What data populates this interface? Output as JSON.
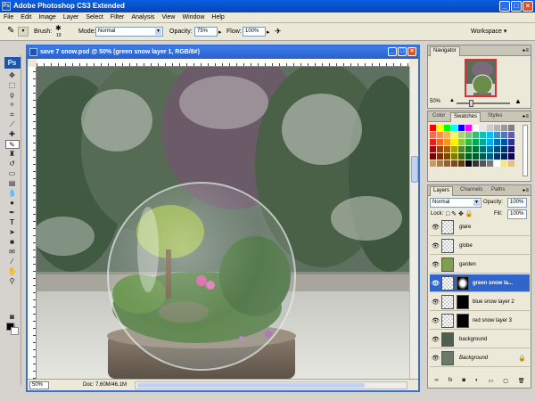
{
  "app": {
    "title": "Adobe Photoshop CS3 Extended",
    "logo": "Ps"
  },
  "menu": [
    "File",
    "Edit",
    "Image",
    "Layer",
    "Select",
    "Filter",
    "Analysis",
    "View",
    "Window",
    "Help"
  ],
  "options": {
    "brush_label": "Brush:",
    "brush_size": "19",
    "mode_label": "Mode:",
    "mode_value": "Normal",
    "opacity_label": "Opacity:",
    "opacity_value": "75%",
    "flow_label": "Flow:",
    "flow_value": "100%",
    "workspace_label": "Workspace ▾"
  },
  "document": {
    "title": "save 7 snow.psd @ 50% (green snow layer 1, RGB/8#)",
    "zoom": "50%",
    "doc_info": "Doc: 7.60M/46.1M"
  },
  "navigator": {
    "tab": "Navigator",
    "zoom": "50%"
  },
  "swatches": {
    "tabs": [
      "Color",
      "Swatches",
      "Styles"
    ],
    "rows": [
      [
        "#ff0000",
        "#ffff00",
        "#00ff00",
        "#00ffff",
        "#0000ff",
        "#ff00ff",
        "#ffffff",
        "#e6e6e6",
        "#cccccc",
        "#b3b3b3",
        "#999999",
        "#808080"
      ],
      [
        "#f26c4f",
        "#f68e55",
        "#fbaf5c",
        "#fff467",
        "#acd372",
        "#7cc576",
        "#3bb878",
        "#1abbb4",
        "#00bff3",
        "#438ccb",
        "#5574b9",
        "#605ca8"
      ],
      [
        "#ed1c24",
        "#f26522",
        "#f7941d",
        "#fff200",
        "#8dc63f",
        "#39b54a",
        "#00a651",
        "#00a99d",
        "#00aeef",
        "#0072bc",
        "#0054a6",
        "#2e3192"
      ],
      [
        "#9e0b0f",
        "#a0410d",
        "#a36209",
        "#aba000",
        "#598527",
        "#197b30",
        "#007236",
        "#00746b",
        "#0076a3",
        "#004b80",
        "#003471",
        "#1b1464"
      ],
      [
        "#790000",
        "#7b2e00",
        "#7d4900",
        "#827b00",
        "#406618",
        "#005e20",
        "#005826",
        "#005952",
        "#005b7f",
        "#003663",
        "#002157",
        "#0d004c"
      ],
      [
        "#c69c6e",
        "#a67c52",
        "#8c6239",
        "#754c24",
        "#603913",
        "#000000",
        "#333333",
        "#555555",
        "#777777",
        "#ffffff",
        "#f0e68c",
        "#e0c090"
      ]
    ]
  },
  "layers": {
    "tabs": [
      "Layers",
      "Channels",
      "Paths"
    ],
    "blend_mode": "Normal",
    "opacity_label": "Opacity:",
    "opacity_value": "100%",
    "lock_label": "Lock:",
    "fill_label": "Fill:",
    "fill_value": "100%",
    "items": [
      {
        "name": "glare"
      },
      {
        "name": "globe"
      },
      {
        "name": "garden"
      },
      {
        "name": "green snow la..."
      },
      {
        "name": "blue snow layer 2"
      },
      {
        "name": "red snow layer 3"
      },
      {
        "name": "background"
      },
      {
        "name": "Background"
      }
    ]
  },
  "icons": {
    "brush": "brush-icon",
    "eye": "eye-icon",
    "lock": "lock-icon"
  }
}
